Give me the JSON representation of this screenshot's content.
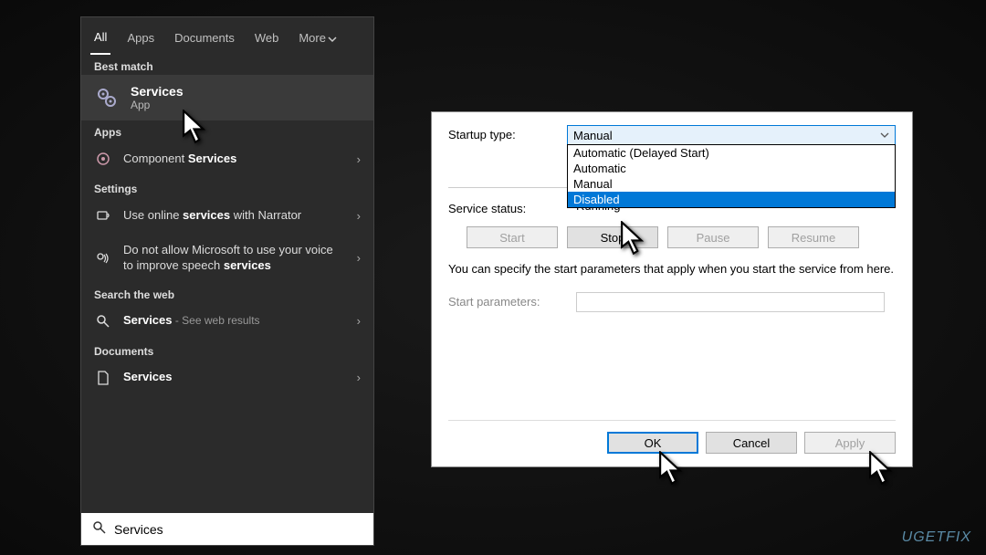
{
  "startmenu": {
    "tabs": {
      "all": "All",
      "apps": "Apps",
      "documents": "Documents",
      "web": "Web",
      "more": "More"
    },
    "best_match_label": "Best match",
    "best": {
      "title": "Services",
      "subtitle": "App"
    },
    "apps_label": "Apps",
    "component_services": {
      "prefix": "Component ",
      "bold": "Services"
    },
    "settings_label": "Settings",
    "narrator": {
      "prefix": "Use online ",
      "bold": "services",
      "suffix": " with Narrator"
    },
    "speech": {
      "prefix": "Do not allow Microsoft to use your voice to improve speech ",
      "bold": "services"
    },
    "search_web_label": "Search the web",
    "web_results": {
      "bold": "Services",
      "suffix": " - See web results"
    },
    "documents_label": "Documents",
    "doc_services": {
      "bold": "Services"
    },
    "search_value": "Services"
  },
  "dialog": {
    "startup_type_label": "Startup type:",
    "selected": "Manual",
    "options": [
      "Automatic (Delayed Start)",
      "Automatic",
      "Manual",
      "Disabled"
    ],
    "service_status_label": "Service status:",
    "service_status_value": "Running",
    "buttons": {
      "start": "Start",
      "stop": "Stop",
      "pause": "Pause",
      "resume": "Resume"
    },
    "description": "You can specify the start parameters that apply when you start the service from here.",
    "start_params_label": "Start parameters:",
    "footer": {
      "ok": "OK",
      "cancel": "Cancel",
      "apply": "Apply"
    }
  },
  "watermark": "UGETFIX"
}
